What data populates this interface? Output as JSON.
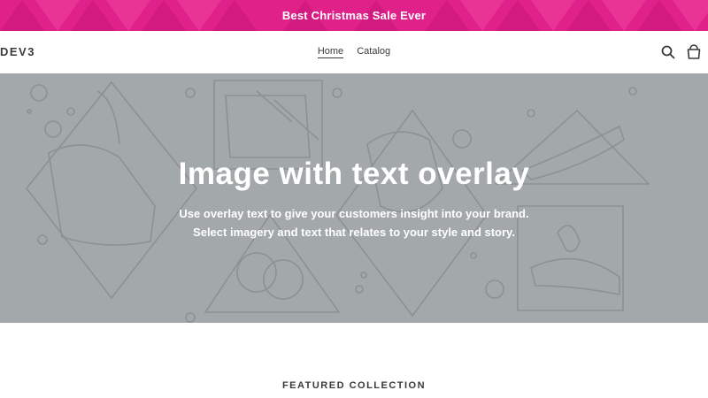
{
  "announcement": {
    "text": "Best Christmas Sale Ever",
    "background": "#e0218a"
  },
  "header": {
    "logo": "DEV3",
    "nav": [
      {
        "label": "Home",
        "active": true
      },
      {
        "label": "Catalog",
        "active": false
      }
    ],
    "icons": [
      "search-icon",
      "cart-icon"
    ]
  },
  "hero": {
    "title": "Image with text overlay",
    "subtitle_line1": "Use overlay text to give your customers insight into your brand.",
    "subtitle_line2": "Select imagery and text that relates to your style and story.",
    "background": "#a3a8ab"
  },
  "featured": {
    "heading": "FEATURED COLLECTION"
  }
}
